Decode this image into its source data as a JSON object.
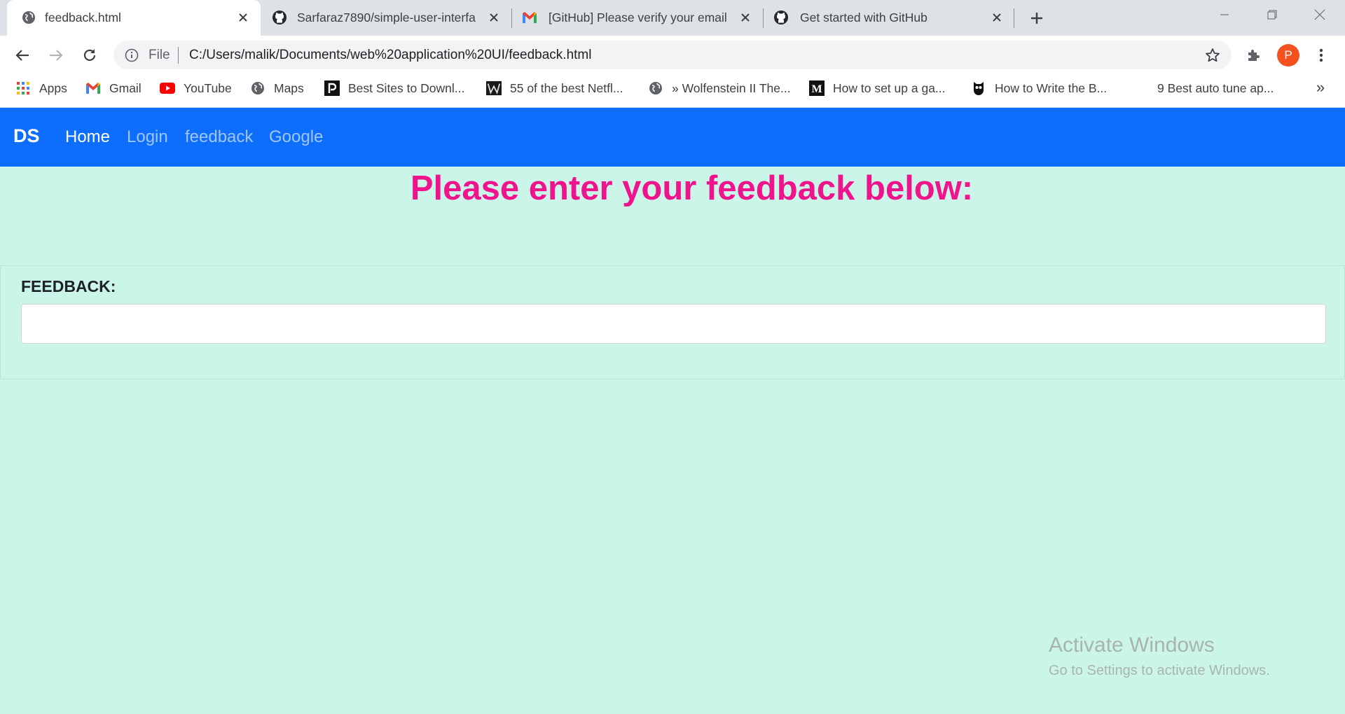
{
  "browser": {
    "tabs": [
      {
        "title": "feedback.html",
        "icon": "globe-icon",
        "active": true
      },
      {
        "title": "Sarfaraz7890/simple-user-interfa",
        "icon": "github-icon",
        "active": false
      },
      {
        "title": "[GitHub] Please verify your email",
        "icon": "gmail-icon",
        "active": false
      },
      {
        "title": "Get started with GitHub",
        "icon": "github-icon",
        "active": false
      }
    ],
    "address_bar": {
      "scheme": "File",
      "url": "C:/Users/malik/Documents/web%20application%20UI/feedback.html"
    },
    "profile_initial": "P",
    "bookmarks": [
      {
        "label": "Apps",
        "icon": "apps-grid-icon"
      },
      {
        "label": "Gmail",
        "icon": "gmail-icon"
      },
      {
        "label": "YouTube",
        "icon": "youtube-icon"
      },
      {
        "label": "Maps",
        "icon": "globe-icon"
      },
      {
        "label": "Best Sites to Downl...",
        "icon": "p-logo-icon"
      },
      {
        "label": "55 of the best Netfl...",
        "icon": "w-logo-icon"
      },
      {
        "label": "» Wolfenstein II The...",
        "icon": "globe-icon"
      },
      {
        "label": "How to set up a ga...",
        "icon": "medium-logo-icon"
      },
      {
        "label": "How to Write the B...",
        "icon": "owl-icon"
      },
      {
        "label": "9 Best auto tune ap...",
        "icon": ""
      }
    ],
    "bookmarks_overflow": "»"
  },
  "navbar": {
    "brand": "DS",
    "links": [
      {
        "label": "Home",
        "active": true
      },
      {
        "label": "Login",
        "active": false
      },
      {
        "label": "feedback",
        "active": false
      },
      {
        "label": "Google",
        "active": false
      }
    ]
  },
  "main": {
    "title": "Please enter your feedback below:",
    "form": {
      "label": "FEEDBACK:",
      "value": "",
      "placeholder": ""
    }
  },
  "watermark": {
    "title": "Activate Windows",
    "subtitle": "Go to Settings to activate Windows."
  },
  "colors": {
    "navbar": "#0d6efd",
    "page_background": "#ccf5ea",
    "title": "#f0148c"
  }
}
